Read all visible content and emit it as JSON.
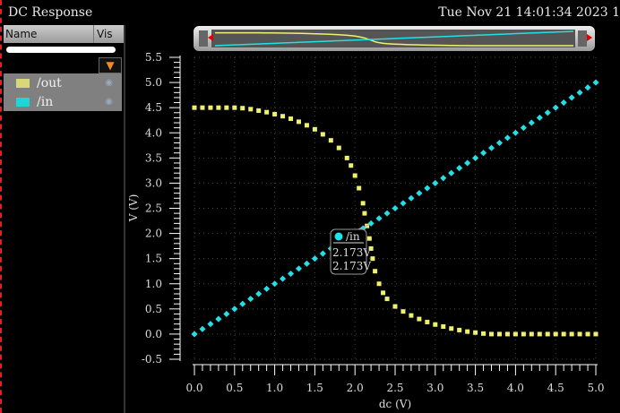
{
  "window": {
    "title": "DC Response",
    "timestamp": "Tue Nov 21 14:01:34 2023  1"
  },
  "browser": {
    "col_name": "Name",
    "col_vis": "Vis",
    "filter_icon": "funnel-icon",
    "signals": [
      {
        "name": "/out",
        "color": "#d8d878"
      },
      {
        "name": "/in",
        "color": "#22d4d4"
      }
    ]
  },
  "marker": {
    "signal": "/in",
    "x_value": "2.173V",
    "y_value": "2.173V"
  },
  "chart_data": {
    "type": "scatter",
    "xlabel": "dc (V)",
    "ylabel": "V (V)",
    "xlim": [
      0,
      5
    ],
    "ylim": [
      -0.5,
      5.5
    ],
    "xticks": [
      "0.0",
      "0.5",
      "1.0",
      "1.5",
      "2.0",
      "2.5",
      "3.0",
      "3.5",
      "4.0",
      "4.5",
      "5.0"
    ],
    "yticks": [
      "-0.5",
      "0.0",
      "0.5",
      "1.0",
      "1.5",
      "2.0",
      "2.5",
      "3.0",
      "3.5",
      "4.0",
      "4.5",
      "5.0",
      "5.5"
    ],
    "series": [
      {
        "name": "/out",
        "color": "#f0f070",
        "x": [
          0,
          0.1,
          0.2,
          0.3,
          0.4,
          0.5,
          0.6,
          0.7,
          0.8,
          0.9,
          1.0,
          1.1,
          1.2,
          1.3,
          1.4,
          1.5,
          1.6,
          1.7,
          1.8,
          1.9,
          1.95,
          2.0,
          2.05,
          2.1,
          2.12,
          2.15,
          2.18,
          2.2,
          2.22,
          2.25,
          2.3,
          2.35,
          2.4,
          2.5,
          2.6,
          2.7,
          2.8,
          2.9,
          3.0,
          3.1,
          3.2,
          3.3,
          3.4,
          3.5,
          3.6,
          3.7,
          3.8,
          3.9,
          4.0,
          4.1,
          4.2,
          4.3,
          4.4,
          4.5,
          4.6,
          4.7,
          4.8,
          4.9,
          5.0
        ],
        "y": [
          4.5,
          4.5,
          4.5,
          4.5,
          4.5,
          4.5,
          4.49,
          4.47,
          4.44,
          4.41,
          4.37,
          4.33,
          4.28,
          4.22,
          4.15,
          4.07,
          3.97,
          3.85,
          3.7,
          3.5,
          3.35,
          3.15,
          2.9,
          2.6,
          2.4,
          2.15,
          1.9,
          1.7,
          1.5,
          1.25,
          1.0,
          0.82,
          0.7,
          0.55,
          0.45,
          0.37,
          0.3,
          0.24,
          0.19,
          0.15,
          0.11,
          0.08,
          0.05,
          0.03,
          0.01,
          0,
          0,
          0,
          0,
          0,
          0,
          0,
          0,
          0,
          0,
          0,
          0,
          0,
          0
        ]
      },
      {
        "name": "/in",
        "color": "#22e0e8",
        "x": [
          0,
          0.1,
          0.2,
          0.3,
          0.4,
          0.5,
          0.6,
          0.7,
          0.8,
          0.9,
          1.0,
          1.1,
          1.2,
          1.3,
          1.4,
          1.5,
          1.6,
          1.7,
          1.8,
          1.9,
          2.0,
          2.1,
          2.2,
          2.3,
          2.4,
          2.5,
          2.6,
          2.7,
          2.8,
          2.9,
          3.0,
          3.1,
          3.2,
          3.3,
          3.4,
          3.5,
          3.6,
          3.7,
          3.8,
          3.9,
          4.0,
          4.1,
          4.2,
          4.3,
          4.4,
          4.5,
          4.6,
          4.7,
          4.8,
          4.9,
          5.0
        ],
        "y": [
          0,
          0.1,
          0.2,
          0.3,
          0.4,
          0.5,
          0.6,
          0.7,
          0.8,
          0.9,
          1.0,
          1.1,
          1.2,
          1.3,
          1.4,
          1.5,
          1.6,
          1.7,
          1.8,
          1.9,
          2.0,
          2.1,
          2.2,
          2.3,
          2.4,
          2.5,
          2.6,
          2.7,
          2.8,
          2.9,
          3.0,
          3.1,
          3.2,
          3.3,
          3.4,
          3.5,
          3.6,
          3.7,
          3.8,
          3.9,
          4.0,
          4.1,
          4.2,
          4.3,
          4.4,
          4.5,
          4.6,
          4.7,
          4.8,
          4.9,
          5.0
        ]
      }
    ],
    "marker_point": [
      2.173,
      2.173
    ]
  }
}
